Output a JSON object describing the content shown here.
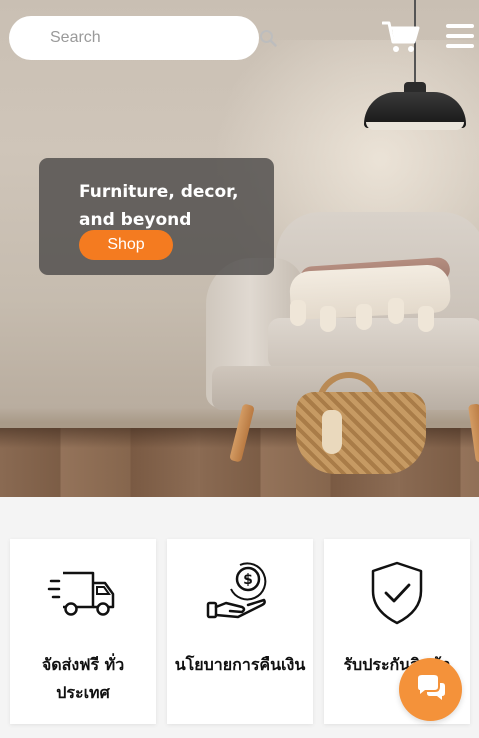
{
  "search": {
    "placeholder": "Search"
  },
  "hero": {
    "title": "Furniture, decor, and beyond",
    "cta_label": "Shop"
  },
  "icons": {
    "search": "search-icon",
    "cart": "cart-icon",
    "menu": "hamburger-menu-icon",
    "chat": "chat-bubbles-icon"
  },
  "colors": {
    "accent": "#f47b20",
    "chat": "#f4923a",
    "promo_overlay": "#4e4c4a"
  },
  "features": [
    {
      "label": "จัดส่งฟรี ทั่วประเทศ",
      "icon": "delivery-truck-icon"
    },
    {
      "label": "นโยบายการคืนเงิน",
      "icon": "money-back-icon"
    },
    {
      "label": "รับประกันสินค้า",
      "icon": "shield-check-icon"
    }
  ]
}
